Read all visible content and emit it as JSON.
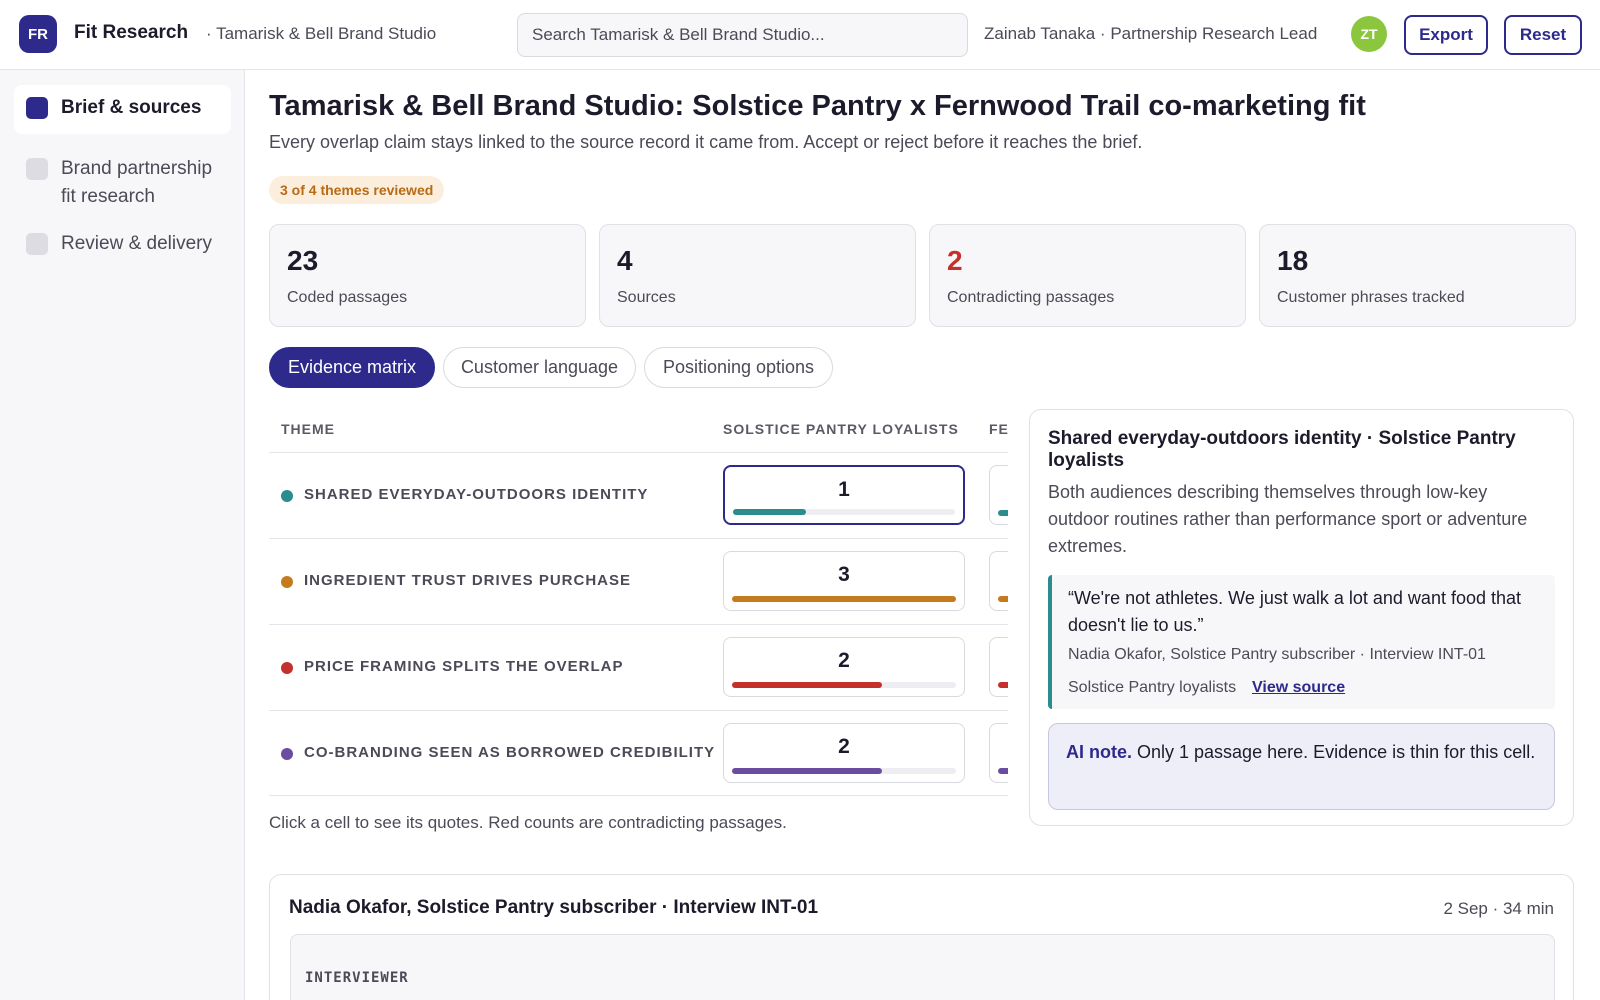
{
  "app": {
    "logo": "FR",
    "name": "Fit Research",
    "breadcrumb": "· Tamarisk & Bell Brand Studio"
  },
  "search": {
    "placeholder": "Search Tamarisk & Bell Brand Studio..."
  },
  "user": {
    "label": "Zainab Tanaka · Partnership Research Lead",
    "initials": "ZT",
    "avatar_color": "#8cc63f"
  },
  "toolbar": {
    "export_label": "Export",
    "reset_label": "Reset"
  },
  "sidebar": {
    "items": [
      {
        "label": "Brief & sources",
        "active": true
      },
      {
        "label": "Brand partnership fit research",
        "active": false
      },
      {
        "label": "Review & delivery",
        "active": false
      }
    ]
  },
  "page": {
    "title": "Tamarisk & Bell Brand Studio: Solstice Pantry x Fernwood Trail co-marketing fit",
    "subtitle": "Every overlap claim stays linked to the source record it came from. Accept or reject before it reaches the brief.",
    "progress_badge": "3 of 4 themes reviewed"
  },
  "stats": [
    {
      "value": "23",
      "label": "Coded passages"
    },
    {
      "value": "4",
      "label": "Sources"
    },
    {
      "value": "2",
      "label": "Contradicting passages",
      "alert": true
    },
    {
      "value": "18",
      "label": "Customer phrases tracked"
    }
  ],
  "tabs": [
    {
      "label": "Evidence matrix",
      "active": true
    },
    {
      "label": "Customer language",
      "active": false
    },
    {
      "label": "Positioning options",
      "active": false
    }
  ],
  "matrix": {
    "columns": [
      "THEME",
      "SOLSTICE PANTRY LOYALISTS",
      "FE"
    ],
    "rows": [
      {
        "theme": "SHARED EVERYDAY-OUTDOORS IDENTITY",
        "color": "#2a8c8c",
        "count": "1",
        "fill": 0.33,
        "selected": true
      },
      {
        "theme": "INGREDIENT TRUST DRIVES PURCHASE",
        "color": "#c67a1e",
        "count": "3",
        "fill": 1.0,
        "selected": false
      },
      {
        "theme": "PRICE FRAMING SPLITS THE OVERLAP",
        "color": "#c4302b",
        "count": "2",
        "fill": 0.67,
        "selected": false
      },
      {
        "theme": "CO-BRANDING SEEN AS BORROWED CREDIBILITY",
        "color": "#6a4ca0",
        "count": "2",
        "fill": 0.67,
        "selected": false
      }
    ],
    "hint": "Click a cell to see its quotes. Red counts are contradicting passages."
  },
  "detail": {
    "title": "Shared everyday-outdoors identity · Solstice Pantry loyalists",
    "description": "Both audiences describing themselves through low-key outdoor routines rather than performance sport or adventure extremes.",
    "quote": "“We're not athletes. We just walk a lot and want food that doesn't lie to us.”",
    "citation": "Nadia Okafor, Solstice Pantry subscriber · Interview INT-01",
    "audience": "Solstice Pantry loyalists",
    "link_label": "View source",
    "ai_label": "AI note.",
    "ai_text": " Only 1 passage here. Evidence is thin for this cell."
  },
  "transcript": {
    "title": "Nadia Okafor, Solstice Pantry subscriber · Interview INT-01",
    "meta": "2 Sep · 34 min",
    "speaker": "INTERVIEWER"
  }
}
